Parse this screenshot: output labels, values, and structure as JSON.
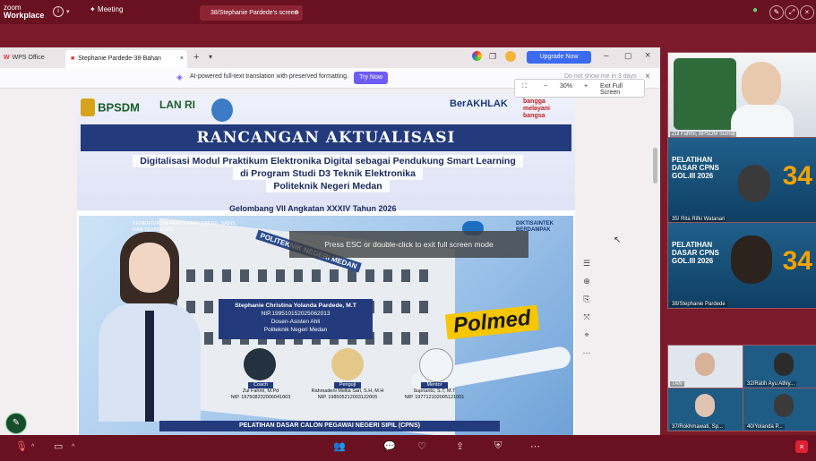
{
  "zoom": {
    "logo_top": "zoom",
    "logo_bottom": "Workplace",
    "meeting_label": "Meeting",
    "share_label": "38/Stephanie Pardede's screen"
  },
  "wps": {
    "tab_wps": "WPS Office",
    "tab_doc": "Stephanie Pardede-38-Bahan",
    "upgrade": "Upgrade Now",
    "ai_text": "AI-powered full-text translation with preserved formatting.",
    "try_now": "Try Now",
    "dont_show": "Do not show me in 3 days",
    "zoom_level": "30%",
    "exit_full": "Exit Full Screen",
    "esc_toast": "Press ESC or double-click to exit full screen mode"
  },
  "document": {
    "logo_bpsdm": "BPSDM",
    "logo_lanri": "LAN RI",
    "logo_berakhlak": "BerAKHLAK",
    "logo_bangga": "bangga melayani bangsa",
    "banner": "RANCANGAN AKTUALISASI",
    "subtitle_1": "Digitalisasi Modul Praktikum Elektronika Digital sebagai Pendukung Smart Learning",
    "subtitle_2": "di Program Studi D3 Teknik Elektronika",
    "subtitle_3": "Politeknik Negeri Medan",
    "gelombang": "Gelombang VII  Angkatan XXXIV Tahun 2026",
    "poster_ministry": "KEMENTERIAN PENDIDIKAN TINGGI, SAINS, DAN TEKNOLOGI",
    "building_sign": "POLITEKNIK NEGERI MEDAN",
    "polmed": "Polmed",
    "diktisaintek": "DIKTISAINTEK BERDAMPAK",
    "name": "Stephanie Christina Yolanda Pardede, M.T",
    "nip": "NIP.199510152025062013",
    "position": "Dosen-Asisten Ahli",
    "institution": "Politeknik Negeri Medan",
    "coach_title": "Coach",
    "coach_name": "Zul Fahmi, M.Pd",
    "coach_nip": "NIP. 197508232006041003",
    "penguji_title": "Penguji",
    "penguji_name": "Rahmadeni Mellia Sari, S.H, M.H",
    "penguji_nip": "NIP. 198505212003122005",
    "mentor_title": "Mentor",
    "mentor_name": "Suprianto, S.T, M.T",
    "mentor_nip": "NIP. 197712102005121001",
    "footer": "PELATIHAN DASAR CALON PEGAWAI NEGERI SIPIL (CPNS)"
  },
  "participants": [
    {
      "label": "Zul Fahmi, BPSDM Sumut"
    },
    {
      "label": "35/ Rita Rifki Watanari",
      "banner": "PELATIHAN DASAR CPNS GOL.III 2026",
      "num": "34"
    },
    {
      "label": "38/Stephanie Pardede",
      "banner": "PELATIHAN DASAR CPNS GOL.III 2026",
      "num": "34"
    },
    {
      "label": "TAN"
    },
    {
      "label": "32/Ratih Ayu Athiy..."
    },
    {
      "label": "37/Rokhmawati, Sp..."
    },
    {
      "label": "40/Yolanda P..."
    }
  ],
  "colors": {
    "zoom_bg": "#7b1a2a",
    "banner_blue": "#233a7c",
    "polmed_yellow": "#f6c600"
  }
}
